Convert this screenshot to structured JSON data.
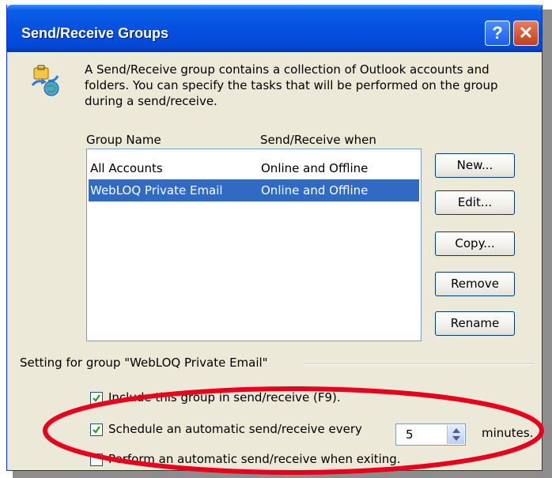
{
  "window": {
    "title": "Send/Receive Groups",
    "help_label": "?",
    "close_label": "✕"
  },
  "intro": {
    "text": "A Send/Receive group contains a collection of Outlook accounts and folders. You can specify the tasks that will be performed on the group during a send/receive.",
    "icon": "send-receive-icon"
  },
  "list": {
    "columns": [
      "Group Name",
      "Send/Receive when"
    ],
    "rows": [
      {
        "name": "All Accounts",
        "when": "Online and Offline",
        "selected": false
      },
      {
        "name": "WebLOQ Private Email",
        "when": "Online and Offline",
        "selected": true
      }
    ]
  },
  "buttons": {
    "new": "New...",
    "edit": "Edit...",
    "copy": "Copy...",
    "remove": "Remove",
    "rename": "Rename"
  },
  "settings": {
    "group_label": "Setting for group \"WebLOQ Private Email\"",
    "include": {
      "label": "Include this group in send/receive (F9).",
      "checked": true
    },
    "schedule": {
      "label": "Schedule an automatic send/receive every",
      "checked": true
    },
    "interval": "5",
    "minutes_label": "minutes.",
    "on_exit": {
      "label": "Perform an automatic send/receive when exiting.",
      "checked": false
    }
  },
  "colors": {
    "title_bar": "#0650e0",
    "selection": "#316ac5",
    "annotation": "#e8001c"
  }
}
